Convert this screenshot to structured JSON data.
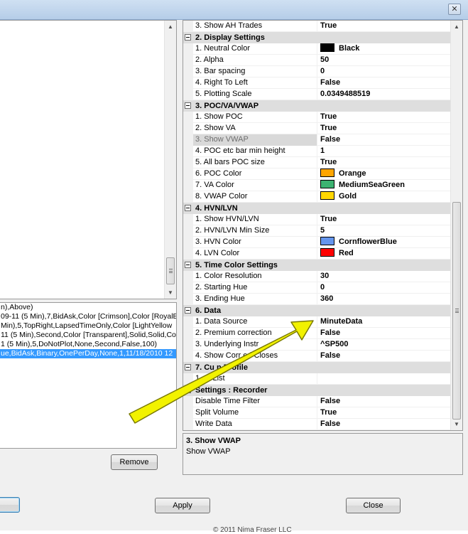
{
  "window": {
    "close_glyph": "✕"
  },
  "left_list_bottom": {
    "rows": [
      {
        "text": "n),Above)",
        "selected": false
      },
      {
        "text": "09-11 (5 Min),7,BidAsk,Color [Crimson],Color [RoyalB",
        "selected": false
      },
      {
        "text": "Min),5,TopRight,LapsedTimeOnly,Color [LightYellow",
        "selected": false
      },
      {
        "text": "11 (5 Min),Second,Color [Transparent],Solid,Solid,Col",
        "selected": false
      },
      {
        "text": "1 (5 Min),5,DoNotPlot,None,Second,False,100)",
        "selected": false
      },
      {
        "text": "ue,BidAsk,Binary,OnePerDay,None,1,11/18/2010 12",
        "selected": true
      }
    ]
  },
  "buttons": {
    "remove": "Remove",
    "apply": "Apply",
    "close": "Close"
  },
  "property_grid": {
    "rows": [
      {
        "kind": "prop",
        "name": "3. Show AH Trades",
        "value": "True"
      },
      {
        "kind": "cat",
        "name": "2. Display Settings"
      },
      {
        "kind": "prop",
        "name": "1. Neutral Color",
        "value": "Black",
        "swatch": "#000000"
      },
      {
        "kind": "prop",
        "name": "2. Alpha",
        "value": "50"
      },
      {
        "kind": "prop",
        "name": "3. Bar spacing",
        "value": "0"
      },
      {
        "kind": "prop",
        "name": "4. Right To Left",
        "value": "False"
      },
      {
        "kind": "prop",
        "name": "5. Plotting Scale",
        "value": "0.0349488519"
      },
      {
        "kind": "cat",
        "name": "3. POC/VA/VWAP"
      },
      {
        "kind": "prop",
        "name": "1. Show POC",
        "value": "True"
      },
      {
        "kind": "prop",
        "name": "2. Show VA",
        "value": "True"
      },
      {
        "kind": "prop",
        "name": "3. Show VWAP",
        "value": "False",
        "highlight": true
      },
      {
        "kind": "prop",
        "name": "4. POC etc bar min height",
        "value": "1"
      },
      {
        "kind": "prop",
        "name": "5. All bars POC size",
        "value": "True"
      },
      {
        "kind": "prop",
        "name": "6. POC Color",
        "value": "Orange",
        "swatch": "#ffa500"
      },
      {
        "kind": "prop",
        "name": "7. VA Color",
        "value": "MediumSeaGreen",
        "swatch": "#3cb371"
      },
      {
        "kind": "prop",
        "name": "8. VWAP Color",
        "value": "Gold",
        "swatch": "#ffd700"
      },
      {
        "kind": "cat",
        "name": "4. HVN/LVN"
      },
      {
        "kind": "prop",
        "name": "1. Show HVN/LVN",
        "value": "True"
      },
      {
        "kind": "prop",
        "name": "2. HVN/LVN Min Size",
        "value": "5"
      },
      {
        "kind": "prop",
        "name": "3. HVN Color",
        "value": "CornflowerBlue",
        "swatch": "#6495ed"
      },
      {
        "kind": "prop",
        "name": "4. LVN Color",
        "value": "Red",
        "swatch": "#ff0000"
      },
      {
        "kind": "cat",
        "name": "5. Time Color Settings"
      },
      {
        "kind": "prop",
        "name": "1. Color Resolution",
        "value": "30"
      },
      {
        "kind": "prop",
        "name": "2. Starting Hue",
        "value": "0"
      },
      {
        "kind": "prop",
        "name": "3. Ending Hue",
        "value": "360"
      },
      {
        "kind": "cat",
        "name": "6. Data"
      },
      {
        "kind": "prop",
        "name": "1. Data Source",
        "value": "MinuteData"
      },
      {
        "kind": "prop",
        "name": "2. Premium correction",
        "value": "False"
      },
      {
        "kind": "prop",
        "name": "3. Underlying Instr",
        "value": "^SP500"
      },
      {
        "kind": "prop",
        "name": "4. Show Corr    ed Closes",
        "value": "False"
      },
      {
        "kind": "cat",
        "name": "7. Cu     n Profile"
      },
      {
        "kind": "prop",
        "name": "1.     ot List",
        "value": ""
      },
      {
        "kind": "cat",
        "name": "Settings : Recorder"
      },
      {
        "kind": "prop",
        "name": "Disable Time Filter",
        "value": "False"
      },
      {
        "kind": "prop",
        "name": "Split Volume",
        "value": "True"
      },
      {
        "kind": "prop",
        "name": "Write Data",
        "value": "False"
      }
    ]
  },
  "description": {
    "title": "3. Show VWAP",
    "text": "Show VWAP"
  },
  "footer_text": "© 2011 Nima Fraser LLC",
  "annotation": {
    "color": "#f2f200",
    "outline": "#7a7a00"
  }
}
